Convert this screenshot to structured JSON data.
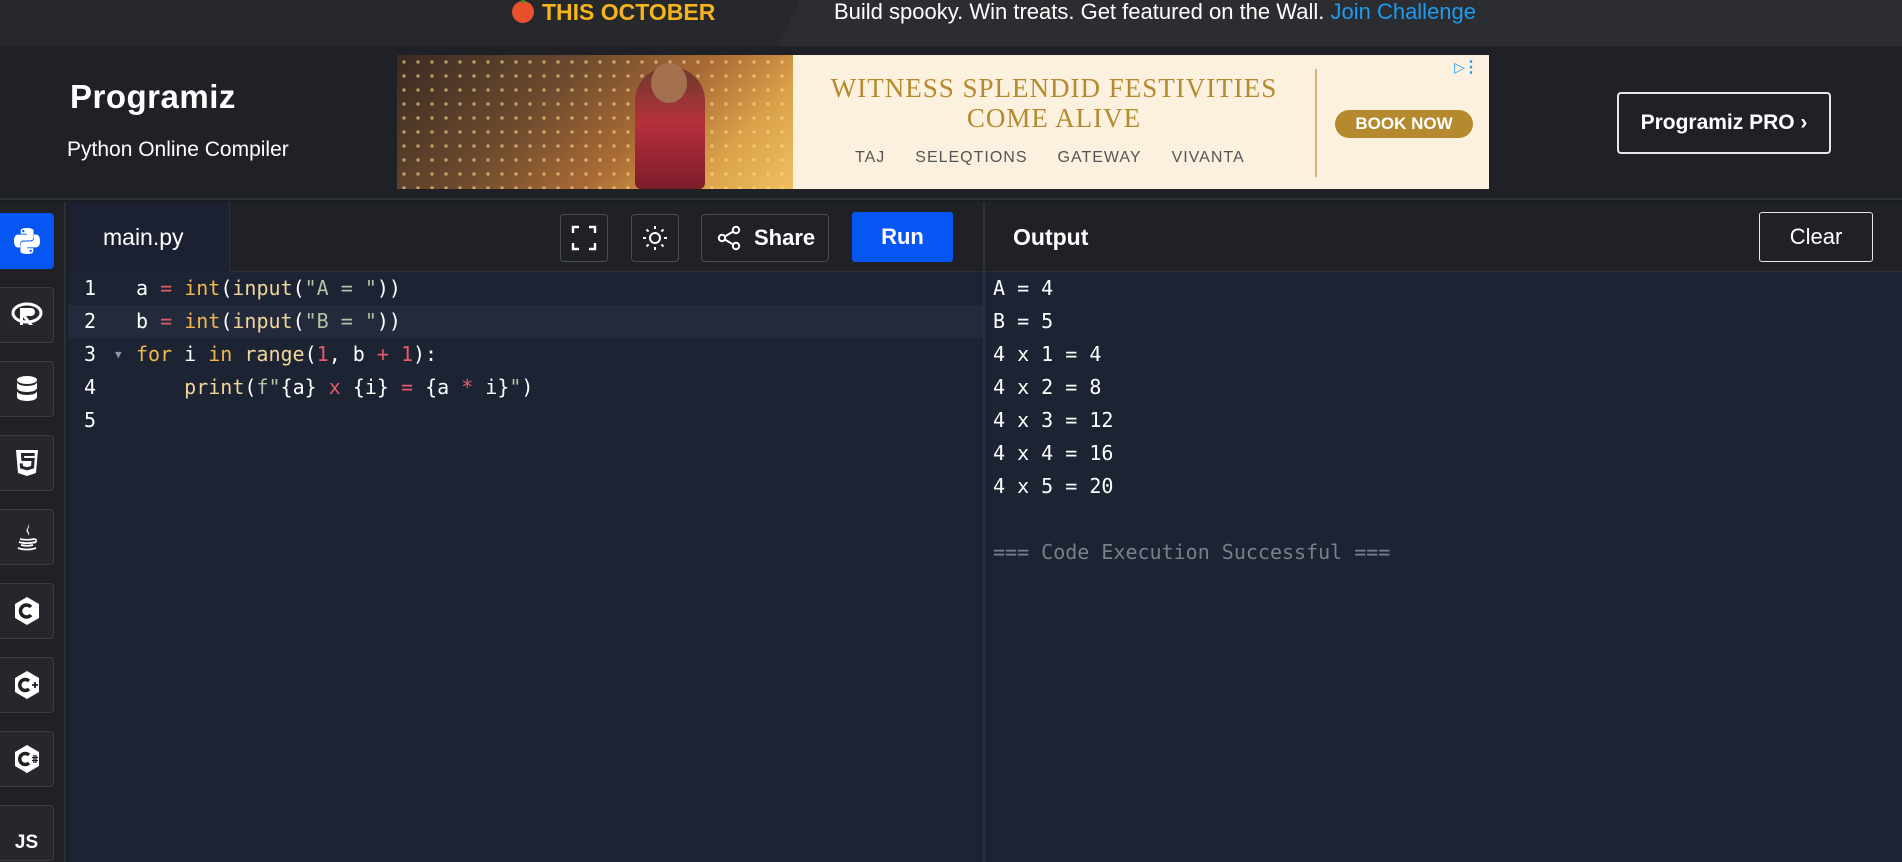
{
  "banner": {
    "promo": "THIS OCTOBER",
    "message": "Build spooky. Win treats. Get featured on the Wall.",
    "link": "Join Challenge"
  },
  "header": {
    "logo": "Programiz",
    "subtitle": "Python Online Compiler",
    "pro_button": "Programiz PRO ›"
  },
  "ad": {
    "headline_1": "WITNESS SPLENDID FESTIVITIES",
    "headline_2": "COME ALIVE",
    "brands": [
      "TAJ",
      "SELEQTIONS",
      "GATEWAY",
      "VIVANTA"
    ],
    "cta": "BOOK NOW"
  },
  "sidebar": {
    "languages": [
      "python-icon",
      "r-icon",
      "database-icon",
      "html5-icon",
      "java-icon",
      "c-icon",
      "cpp-icon",
      "csharp-icon"
    ],
    "last_label": "JS"
  },
  "editor": {
    "tab": "main.py",
    "share_label": "Share",
    "run_label": "Run",
    "line_numbers": [
      "1",
      "2",
      "3",
      "4",
      "5"
    ]
  },
  "output": {
    "title": "Output",
    "clear_label": "Clear",
    "lines": [
      "A = 4",
      "B = 5",
      "4 x 1 = 4",
      "4 x 2 = 8",
      "4 x 3 = 12",
      "4 x 4 = 16",
      "4 x 5 = 20",
      "",
      "=== Code Execution Successful ==="
    ]
  },
  "colors": {
    "accent": "#0556f3",
    "promo": "#f5b51a",
    "link": "#1e9bf0",
    "editor_bg": "#1c2333"
  }
}
